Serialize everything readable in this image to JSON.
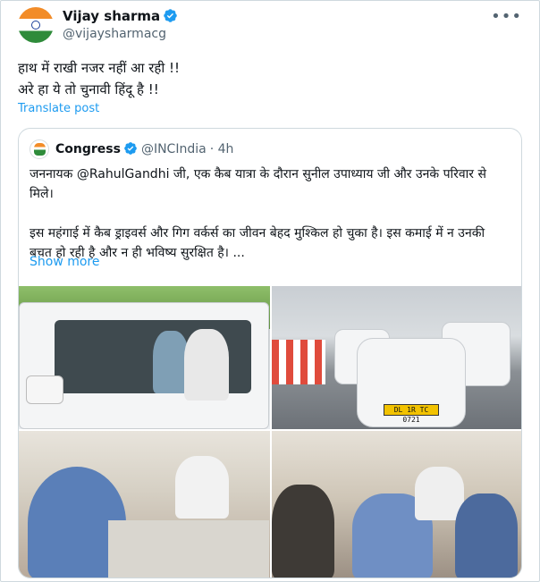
{
  "post": {
    "author_name": "Vijay sharma",
    "author_handle": "@vijaysharmacg",
    "text": "हाथ में राखी नजर नहीं आ रही !!\nअरे हा ये तो चुनावी हिंदू है !!",
    "translate_label": "Translate post",
    "more_label": "•••"
  },
  "quote": {
    "author_name": "Congress",
    "author_handle": "@INCIndia",
    "time": "· 4h",
    "text": "जननायक @RahulGandhi जी, एक कैब यात्रा के दौरान सुनील उपाध्याय जी और उनके परिवार से मिले।\n\nइस महंगाई में कैब ड्राइवर्स और गिग वर्कर्स का जीवन बेहद मुश्किल हो चुका है। इस कमाई में न उनकी बचत हो रही है और न ही भविष्य सुरक्षित है। ...",
    "show_more_label": "Show more",
    "license_plate": "DL 1R TC 0721"
  },
  "colors": {
    "accent": "#1d9bf0",
    "verified": "#1d9bf0",
    "muted": "#536471",
    "border": "#cfd9de"
  }
}
